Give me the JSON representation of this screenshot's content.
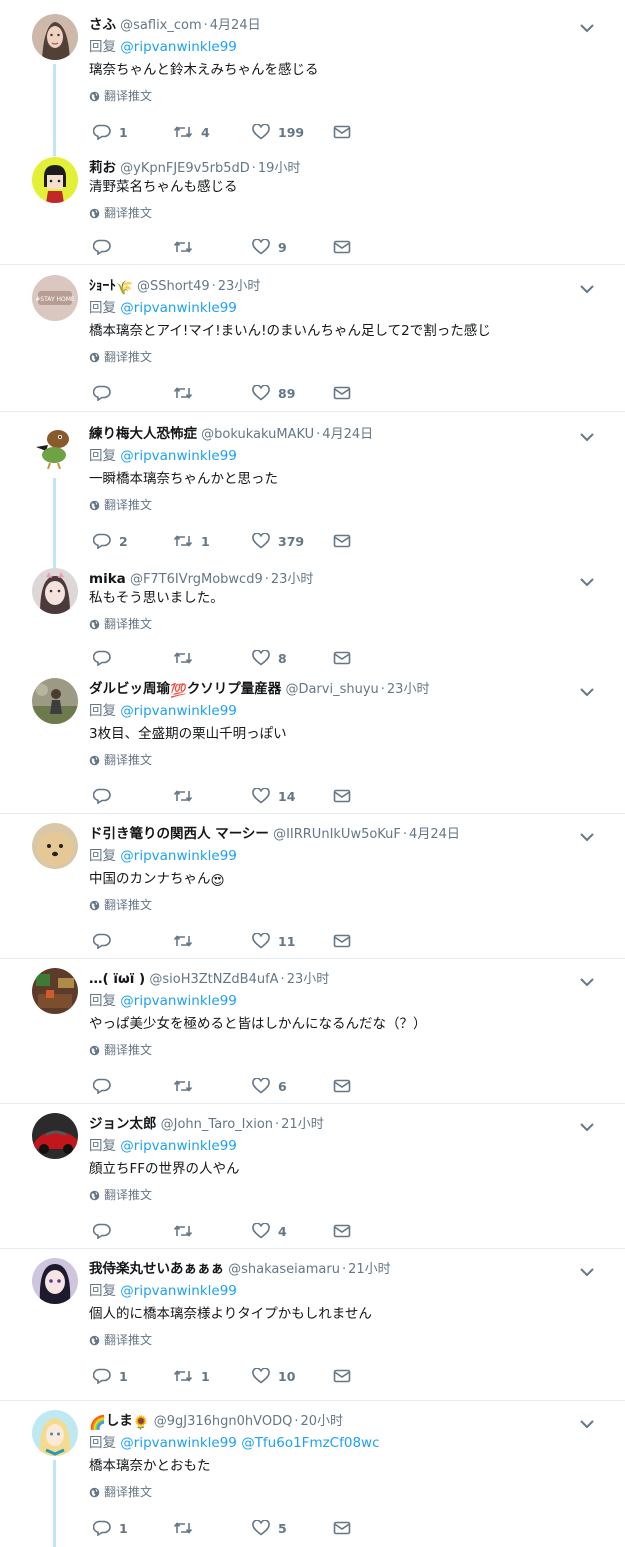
{
  "translate_label": "翻译推文",
  "reply_prefix": "回复",
  "tweets": [
    {
      "name": "さふ",
      "handle": "@saflix_com",
      "time": "4月24日",
      "reply_to": "@ripvanwinkle99",
      "reply_to2": "",
      "text": "璃奈ちゃんと鈴木えみちゃんを感じる",
      "replies": "1",
      "retweets": "4",
      "likes": "199",
      "avatar": "woman-avatar"
    },
    {
      "name": "莉お",
      "handle": "@yKpnFJE9v5rb5dD",
      "time": "19小时",
      "reply_to": "",
      "reply_to2": "",
      "text": "清野菜名ちゃんも感じる",
      "replies": "",
      "retweets": "",
      "likes": "9",
      "avatar": "cartoon-avatar"
    },
    {
      "name": "ｼｮｰﾄ",
      "handle": "@SShort49",
      "time": "23小时",
      "reply_to": "@ripvanwinkle99",
      "reply_to2": "",
      "text": "橋本璃奈とアイ!マイ!まいん!のまいんちゃん足して2で割った感じ",
      "replies": "",
      "retweets": "",
      "likes": "89",
      "avatar": "stay-home-avatar",
      "name_emoji": "🌾"
    },
    {
      "name": "練り梅大人恐怖症",
      "handle": "@bokukakuMAKU",
      "time": "4月24日",
      "reply_to": "@ripvanwinkle99",
      "reply_to2": "",
      "text": "一瞬橋本璃奈ちゃんかと思った",
      "replies": "2",
      "retweets": "1",
      "likes": "379",
      "avatar": "bird-avatar"
    },
    {
      "name": "mika",
      "handle": "@F7T6IVrgMobwcd9",
      "time": "23小时",
      "reply_to": "",
      "reply_to2": "",
      "text": "私もそう思いました。",
      "replies": "",
      "retweets": "",
      "likes": "8",
      "avatar": "girl-avatar"
    },
    {
      "name": "ダルビッ周瑜",
      "name_suffix": "クソリプ量産器",
      "name_emoji": "💯",
      "handle": "@Darvi_shuyu",
      "time": "23小时",
      "reply_to": "@ripvanwinkle99",
      "reply_to2": "",
      "text": "3枚目、全盛期の栗山千明っぽい",
      "replies": "",
      "retweets": "",
      "likes": "14",
      "avatar": "figure-avatar"
    },
    {
      "name": "ド引き篭りの関西人 マーシー",
      "handle": "@IIRRUnIkUw5oKuF",
      "time": "4月24日",
      "reply_to": "@ripvanwinkle99",
      "reply_to2": "",
      "text": "中国のカンナちゃん",
      "text_emoji": "😍",
      "replies": "",
      "retweets": "",
      "likes": "11",
      "avatar": "dog-avatar"
    },
    {
      "name": "…( ïωï )",
      "handle": "@sioH3ZtNZdB4ufA",
      "time": "23小时",
      "reply_to": "@ripvanwinkle99",
      "reply_to2": "",
      "text": "やっぱ美少女を極めると皆はしかんになるんだな（？）",
      "replies": "",
      "retweets": "",
      "likes": "6",
      "avatar": "game-avatar"
    },
    {
      "name": "ジョン太郎",
      "handle": "@John_Taro_Ixion",
      "time": "21小时",
      "reply_to": "@ripvanwinkle99",
      "reply_to2": "",
      "text": "顔立ちFFの世界の人やん",
      "replies": "",
      "retweets": "",
      "likes": "4",
      "avatar": "car-avatar"
    },
    {
      "name": "我侍楽丸せいあぁぁぁ",
      "handle": "@shakaseiamaru",
      "time": "21小时",
      "reply_to": "@ripvanwinkle99",
      "reply_to2": "",
      "text": "個人的に橋本璃奈様よりタイプかもしれません",
      "replies": "1",
      "retweets": "1",
      "likes": "10",
      "avatar": "anime-girl-avatar"
    },
    {
      "name": "しま",
      "name_prefix_emoji": "🌈",
      "name_emoji": "🌻",
      "handle": "@9gJ316hgn0hVODQ",
      "time": "20小时",
      "reply_to": "@ripvanwinkle99",
      "reply_to2": "@Tfu6o1FmzCf08wc",
      "text": "橋本璃奈かとおもた",
      "replies": "1",
      "retweets": "",
      "likes": "5",
      "avatar": "blonde-avatar"
    }
  ],
  "colors": {
    "accent": "#1da1f2",
    "muted": "#657786",
    "thread": "#c3e4f6",
    "separator": "#e6ecf0"
  }
}
